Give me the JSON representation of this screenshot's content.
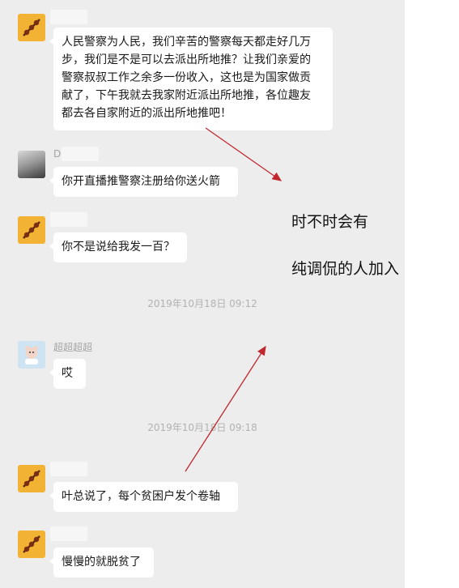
{
  "messages": [
    {
      "sender": "",
      "lines": [
        "人民警察为人民，我们辛苦的警察每天都走好几万",
        "步，我们是不是可以去派出所地推？让我们亲爱的",
        "警察叔叔工作之余多一份收入，这也是为国家做贡",
        "献了，下午我就去我家附近派出所地推，各位趣友",
        "都去各自家附近的派出所地推吧！"
      ]
    },
    {
      "sender": "D",
      "text": "你开直播推警察注册给你送火箭"
    },
    {
      "sender": "",
      "text": "你不是说给我发一百？"
    },
    {
      "sender": "超超超超",
      "text": "哎"
    },
    {
      "sender": "",
      "text": "叶总说了，每个贫困户发个卷轴"
    },
    {
      "sender": "",
      "text": "慢慢的就脱贫了"
    }
  ],
  "timestamps": [
    "2019年10月18日 09:12",
    "2019年10月18日 09:18"
  ],
  "annotations": [
    "时不时会有",
    "纯调侃的人加入"
  ],
  "colors": {
    "chat_background": "#ededed",
    "bubble": "#ffffff",
    "arrow": "#c0282e",
    "avatar_orange": "#f2b233"
  },
  "icons": {
    "avatar_1": "orange-scroll-avatar",
    "avatar_2": "photo-avatar",
    "avatar_4": "cartoon-avatar"
  }
}
